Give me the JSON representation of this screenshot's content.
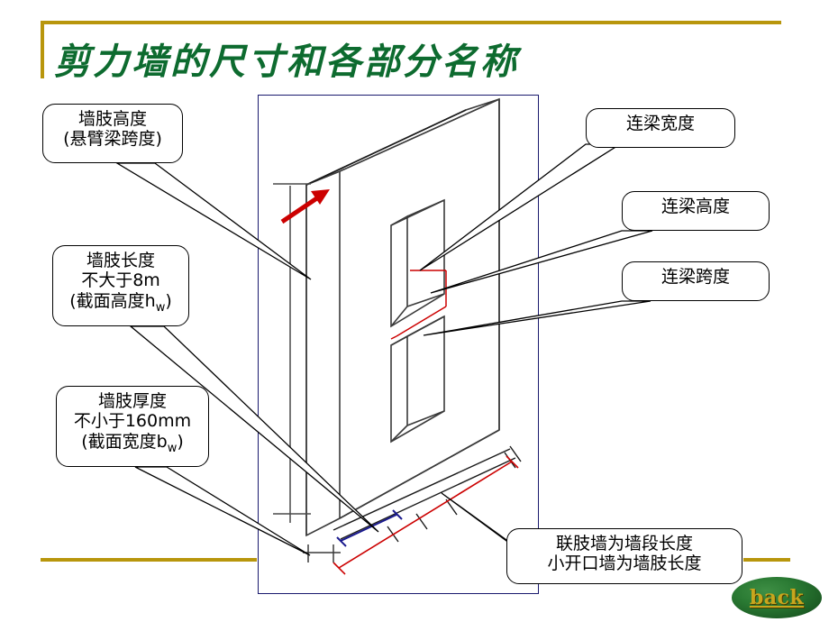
{
  "slide": {
    "title": "剪力墙的尺寸和各部分名称",
    "title_color": "#0d6b2f",
    "accent_color": "#b8960c",
    "background": "#ffffff"
  },
  "diagram": {
    "name": "shear-wall-isometric-drawing",
    "frame_color": "#1a1a6e",
    "arrow_color": "#cc0000",
    "dimension_red": "#cc0000",
    "dimension_blue": "#1a1a8e",
    "line_color": "#3a3a3a"
  },
  "callouts": {
    "leg_height": {
      "line1": "墙肢高度",
      "line2": "(悬臂梁跨度)"
    },
    "leg_length": {
      "line1": "墙肢长度",
      "line2": "不大于8m",
      "line3_pre": "(截面高度h",
      "line3_sub": "w",
      "line3_post": ")"
    },
    "leg_thickness": {
      "line1": "墙肢厚度",
      "line2": "不小于160mm",
      "line3_pre": "(截面宽度b",
      "line3_sub": "w",
      "line3_post": ")"
    },
    "beam_width": {
      "line1": "连梁宽度"
    },
    "beam_height": {
      "line1": "连梁高度"
    },
    "beam_span": {
      "line1": "连梁跨度"
    },
    "wall_segment": {
      "line1": "联肢墙为墙段长度",
      "line2": "小开口墙为墙肢长度"
    }
  },
  "nav": {
    "back_label": "back",
    "back_text_color": "#c8a61e",
    "back_fill_color": "#2a7a33"
  }
}
